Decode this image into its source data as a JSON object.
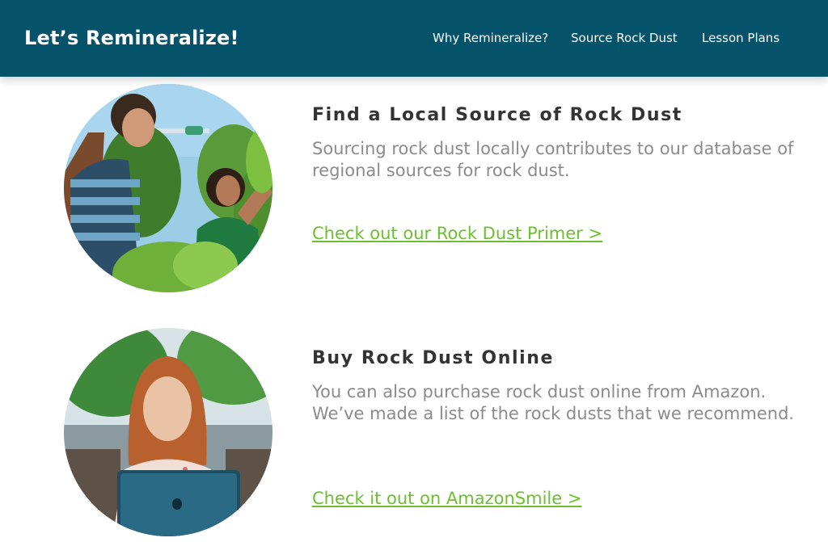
{
  "header": {
    "logo": "Let’s Remineralize!",
    "nav": [
      {
        "label": "Why Remineralize?"
      },
      {
        "label": "Source Rock Dust"
      },
      {
        "label": "Lesson Plans"
      }
    ]
  },
  "sections": [
    {
      "title": "Find a Local Source of Rock Dust",
      "description": "Sourcing rock dust locally contributes to our database of regional sources for rock dust.",
      "link": "Check out our Rock Dust Primer >"
    },
    {
      "title": "Buy Rock Dust Online",
      "description": "You can also purchase rock dust online from Amazon. We’ve made a list of the rock dusts that we recommend.",
      "link": "Check it out on AmazonSmile >"
    }
  ],
  "colors": {
    "header_bg": "#05536b",
    "link": "#6cc02f",
    "title": "#333333",
    "description": "#8b8b8b"
  }
}
